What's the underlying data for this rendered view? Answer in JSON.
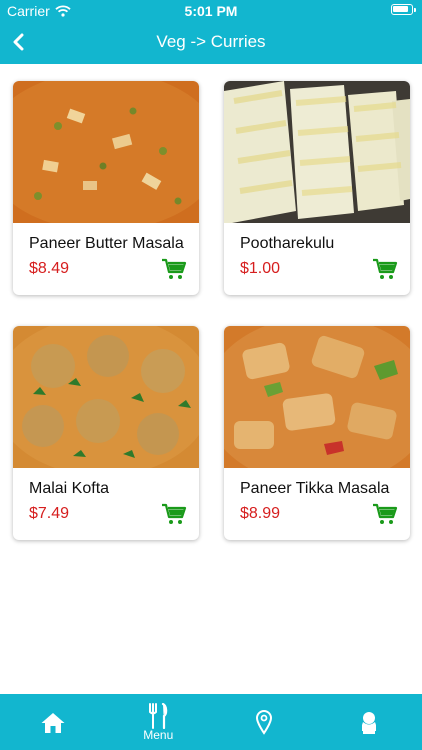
{
  "status_bar": {
    "carrier": "Carrier",
    "time": "5:01 PM"
  },
  "nav": {
    "title": "Veg -> Curries"
  },
  "products": [
    {
      "name": "Paneer Butter Masala",
      "price": "$8.49"
    },
    {
      "name": "Pootharekulu",
      "price": "$1.00"
    },
    {
      "name": "Malai Kofta",
      "price": "$7.49"
    },
    {
      "name": "Paneer Tikka Masala",
      "price": "$8.99"
    }
  ],
  "tab_bar": {
    "menu_label": "Menu"
  },
  "colors": {
    "accent": "#12b6cf",
    "price": "#d61e1e",
    "cart": "#1a9a1a"
  },
  "icons": [
    "chevron-left-icon",
    "wifi-icon",
    "battery-icon",
    "cart-icon",
    "home-icon",
    "fork-knife-icon",
    "location-pin-icon",
    "person-icon"
  ]
}
